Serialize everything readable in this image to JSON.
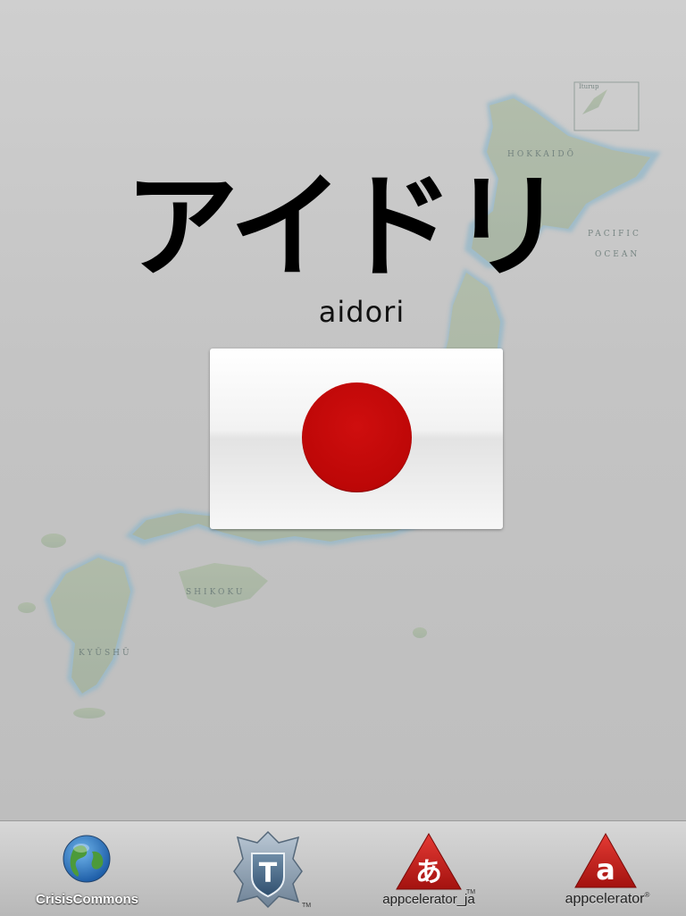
{
  "app": {
    "title_japanese": "アイドリ",
    "title_romaji": "aidori"
  },
  "map": {
    "labels": {
      "hokkaido": "HOKKAIDŌ",
      "pacific": "PACIFIC",
      "ocean": "OCEAN",
      "shikoku": "SHIKOKU",
      "kyushu": "KYŪSHŪ",
      "iturup": "Iturup"
    }
  },
  "flag": {
    "disc_color": "#bd0707",
    "field_color": "#ffffff"
  },
  "sponsors": [
    {
      "label": "CrisisCommons",
      "icon": "globe-icon"
    },
    {
      "label": "",
      "icon": "titanium-shield-icon",
      "tm": "TM"
    },
    {
      "label": "appcelerator_ja",
      "icon": "appcelerator-ja-icon",
      "glyph": "あ",
      "tm": "TM"
    },
    {
      "label": "appcelerator",
      "icon": "appcelerator-icon",
      "glyph": "a",
      "reg": "®"
    }
  ]
}
